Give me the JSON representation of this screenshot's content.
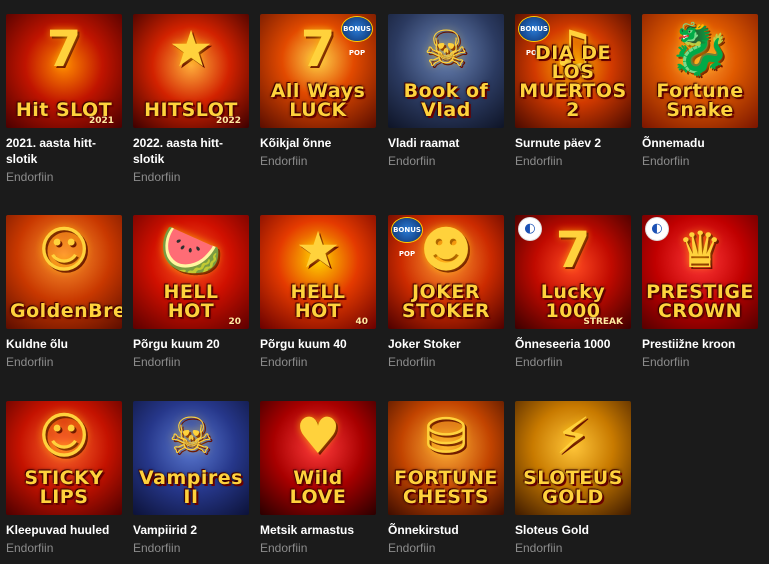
{
  "games": [
    {
      "title": "2021. aasta hitt-slotik",
      "provider": "Endorfiin",
      "logo": "Hit SLOT",
      "logo_sub": "2021",
      "icon": "lucky-seven-icon",
      "glyph": "7",
      "theme": "t1",
      "badge": ""
    },
    {
      "title": "2022. aasta hitt-slotik",
      "provider": "Endorfiin",
      "logo": "HITSLOT",
      "logo_sub": "2022",
      "icon": "star-icon",
      "glyph": "★",
      "theme": "t2",
      "badge": ""
    },
    {
      "title": "Kõikjal õnne",
      "provider": "Endorfiin",
      "logo": "All Ways\nLUCK",
      "logo_sub": "",
      "icon": "lucky-seven-icon",
      "glyph": "7",
      "theme": "t3",
      "badge": "BONUS POP"
    },
    {
      "title": "Vladi raamat",
      "provider": "Endorfiin",
      "logo": "Book of Vlad",
      "logo_sub": "",
      "icon": "vampire-portrait-icon",
      "glyph": "☠",
      "theme": "t4",
      "badge": ""
    },
    {
      "title": "Surnute päev 2",
      "provider": "Endorfiin",
      "logo": "DIA DE LOS\nMUERTOS 2",
      "logo_sub": "",
      "icon": "guitar-icon",
      "glyph": "♫",
      "theme": "t5",
      "badge": "BONUS POP"
    },
    {
      "title": "Õnnemadu",
      "provider": "Endorfiin",
      "logo": "Fortune\nSnake",
      "logo_sub": "",
      "icon": "snake-icon",
      "glyph": "🐉",
      "theme": "t6",
      "badge": ""
    },
    {
      "title": "Kuldne õlu",
      "provider": "Endorfiin",
      "logo": "GoldenBrew",
      "logo_sub": "",
      "icon": "barmaid-portrait-icon",
      "glyph": "☺",
      "theme": "t7",
      "badge": ""
    },
    {
      "title": "Põrgu kuum 20",
      "provider": "Endorfiin",
      "logo": "HELL HOT",
      "logo_sub": "20",
      "icon": "fruit-icon",
      "glyph": "🍉",
      "theme": "t8",
      "badge": ""
    },
    {
      "title": "Põrgu kuum 40",
      "provider": "Endorfiin",
      "logo": "HELL HOT",
      "logo_sub": "40",
      "icon": "star-icon",
      "glyph": "★",
      "theme": "t9",
      "badge": ""
    },
    {
      "title": "Joker Stoker",
      "provider": "Endorfiin",
      "logo": "JOKER\nSTOKER",
      "logo_sub": "",
      "icon": "joker-portrait-icon",
      "glyph": "☻",
      "theme": "t10",
      "badge": "BONUS POP"
    },
    {
      "title": "Õnneseeria 1000",
      "provider": "Endorfiin",
      "logo": "Lucky 1000",
      "logo_sub": "STREAK",
      "icon": "lucky-seven-icon",
      "glyph": "7",
      "theme": "t11",
      "badge": "PROVIDER"
    },
    {
      "title": "Prestiižne kroon",
      "provider": "Endorfiin",
      "logo": "PRESTIGE\nCROWN",
      "logo_sub": "",
      "icon": "crown-icon",
      "glyph": "♛",
      "theme": "t12",
      "badge": "PROVIDER"
    },
    {
      "title": "Kleepuvad huuled",
      "provider": "Endorfiin",
      "logo": "STICKY\nLIPS",
      "logo_sub": "",
      "icon": "jester-portrait-icon",
      "glyph": "☺",
      "theme": "t13",
      "badge": ""
    },
    {
      "title": "Vampiirid 2",
      "provider": "Endorfiin",
      "logo": "Vampires II",
      "logo_sub": "",
      "icon": "vampire-portrait-icon",
      "glyph": "☠",
      "theme": "t14",
      "badge": ""
    },
    {
      "title": "Metsik armastus",
      "provider": "Endorfiin",
      "logo": "Wild LOVE",
      "logo_sub": "",
      "icon": "heart-icon",
      "glyph": "♥",
      "theme": "t15",
      "badge": ""
    },
    {
      "title": "Õnnekirstud",
      "provider": "Endorfiin",
      "logo": "FORTUNE\nCHESTS",
      "logo_sub": "",
      "icon": "treasure-chest-icon",
      "glyph": "⛁",
      "theme": "t16",
      "badge": ""
    },
    {
      "title": "Sloteus Gold",
      "provider": "Endorfiin",
      "logo": "SLOTEUS\nGOLD",
      "logo_sub": "",
      "icon": "zeus-portrait-icon",
      "glyph": "⚡",
      "theme": "t17",
      "badge": ""
    }
  ],
  "badge_labels": {
    "bonus_pop": "BONUS POP",
    "provider_mark": "◐"
  },
  "colors": {
    "background": "#1b1b1b",
    "title": "#ffffff",
    "provider": "#8c8c8c",
    "logo_gold": "#ffd23c"
  }
}
